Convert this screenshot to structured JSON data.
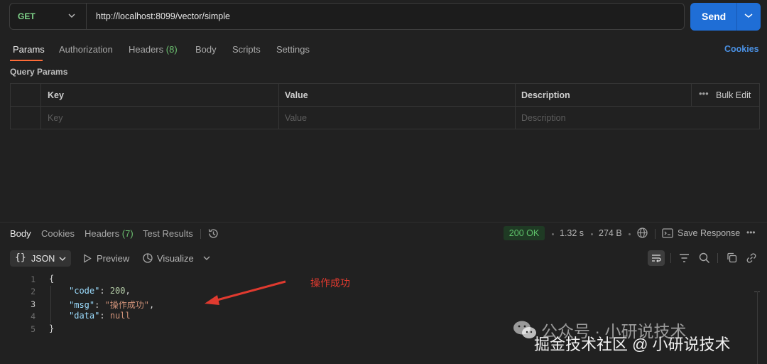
{
  "request": {
    "method": "GET",
    "url": "http://localhost:8099/vector/simple",
    "send_label": "Send"
  },
  "request_tabs": {
    "params": "Params",
    "authorization": "Authorization",
    "headers": "Headers",
    "headers_count": "(8)",
    "body": "Body",
    "scripts": "Scripts",
    "settings": "Settings",
    "cookies": "Cookies"
  },
  "query_params": {
    "title": "Query Params",
    "columns": [
      "Key",
      "Value",
      "Description"
    ],
    "bulk_edit": "Bulk Edit",
    "placeholders": [
      "Key",
      "Value",
      "Description"
    ]
  },
  "response_tabs": {
    "body": "Body",
    "cookies": "Cookies",
    "headers": "Headers",
    "headers_count": "(7)",
    "test_results": "Test Results"
  },
  "response_meta": {
    "status": "200 OK",
    "time": "1.32 s",
    "size": "274 B",
    "save_response": "Save Response"
  },
  "response_toolbar": {
    "format": "JSON",
    "preview": "Preview",
    "visualize": "Visualize"
  },
  "code": {
    "line_numbers": [
      "1",
      "2",
      "3",
      "4",
      "5"
    ],
    "open_brace": "{",
    "close_brace": "}",
    "code_key": "\"code\"",
    "code_value": "200",
    "msg_key": "\"msg\"",
    "msg_value": "\"操作成功\"",
    "data_key": "\"data\"",
    "data_value": "null",
    "colon": ": ",
    "comma": ","
  },
  "annotation": "操作成功",
  "watermark": {
    "line1": "公众号 · 小研说技术",
    "line2": "掘金技术社区 @ 小研说技术"
  },
  "colors": {
    "accent_orange": "#ff6c37",
    "send_blue": "#1f6ed6",
    "status_green": "#5ec26a",
    "annotation_red": "#e03a2f"
  }
}
